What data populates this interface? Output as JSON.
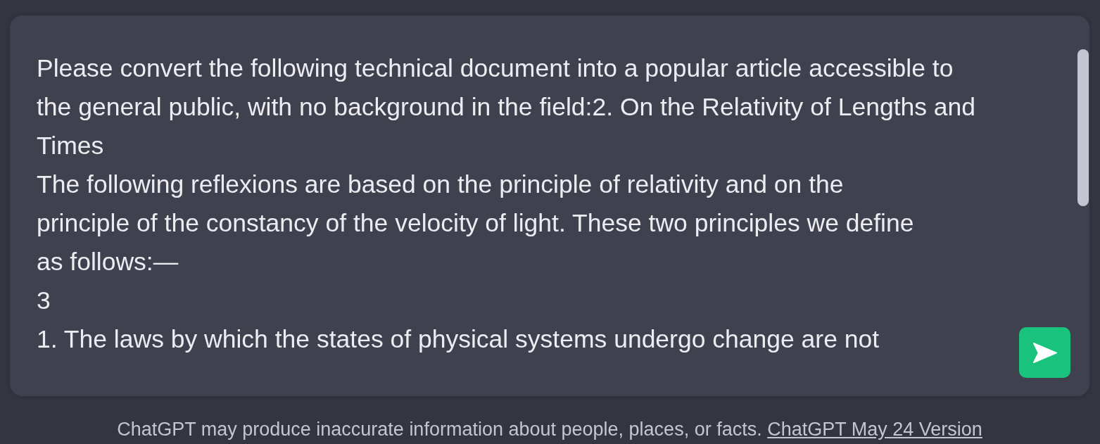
{
  "composer": {
    "value_lines": [
      "Please convert the following technical document into a popular article accessible to",
      "the general public, with no background in the field:2. On the Relativity of Lengths and",
      "Times",
      "The following reflexions are based on the principle of relativity and on the",
      "principle of the constancy of the velocity of light. These two principles we define",
      "as follows:—",
      "3",
      "1. The laws by which the states of physical systems undergo change are not"
    ]
  },
  "footer": {
    "disclaimer": "ChatGPT may produce inaccurate information about people, places, or facts.",
    "link": "ChatGPT May 24 Version"
  }
}
